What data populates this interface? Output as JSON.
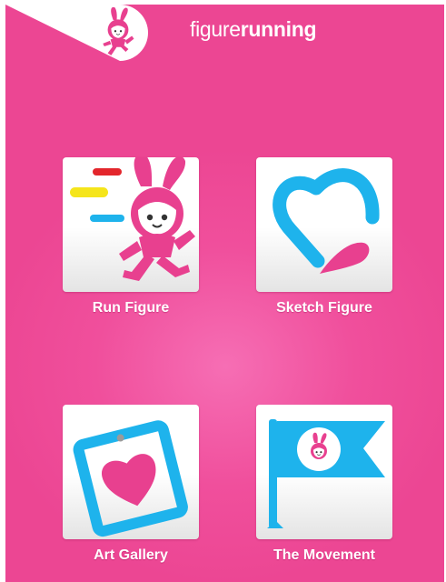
{
  "header": {
    "brand_light": "figure",
    "brand_bold": "running",
    "logo_icon": "bunny-mascot-icon"
  },
  "menu": {
    "items": [
      {
        "label": "Run Figure",
        "icon": "running-bunny-icon"
      },
      {
        "label": "Sketch Figure",
        "icon": "heart-sketch-icon"
      },
      {
        "label": "Art Gallery",
        "icon": "heart-frame-icon"
      },
      {
        "label": "The Movement",
        "icon": "flag-icon"
      }
    ]
  },
  "colors": {
    "background": "#ec4693",
    "background_glow": "#f66eb4",
    "pink": "#e8408f",
    "blue": "#1eb3ec",
    "yellow": "#f5e51b",
    "red": "#e3262c",
    "tile": "#ffffff"
  }
}
